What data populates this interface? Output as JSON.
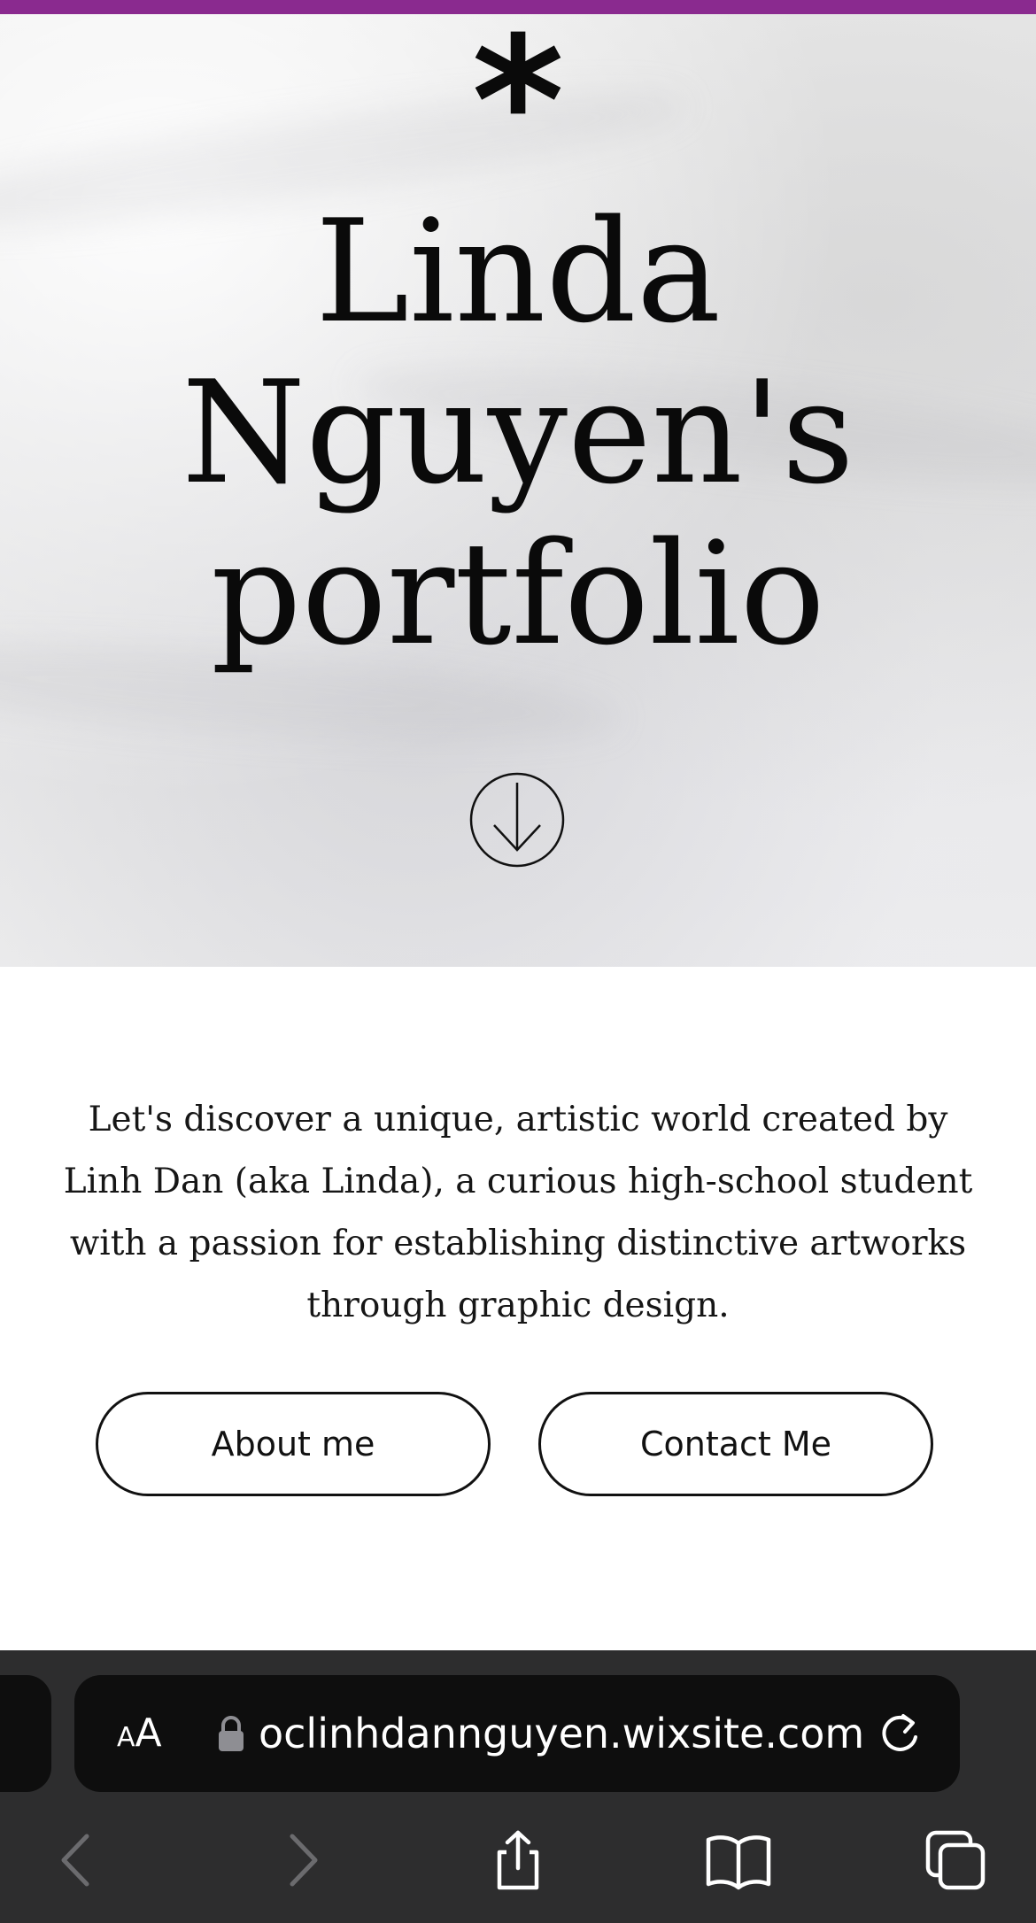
{
  "hero": {
    "logo_glyph": "*",
    "title_line1": "Linda",
    "title_line2": "Nguyen's",
    "title_line3": "portfolio",
    "scroll_icon": "arrow-down-circle-icon"
  },
  "intro": {
    "text": "Let's discover a unique, artistic world created by Linh Dan (aka Linda), a curious high-school student with a passion for establishing distinctive artworks through graphic design."
  },
  "buttons": {
    "about": "About me",
    "contact": "Contact Me"
  },
  "browser": {
    "text_size_small": "A",
    "text_size_big": "A",
    "url": "oclinhdannguyen.wixsite.com",
    "icons": [
      "lock-icon",
      "reload-icon",
      "back-icon",
      "forward-icon",
      "share-icon",
      "bookmarks-icon",
      "tabs-icon"
    ]
  },
  "colors": {
    "accent_bar": "#8a2a8f",
    "chrome_bg": "#2d2d2e",
    "url_bar_bg": "#0e0e0e"
  }
}
